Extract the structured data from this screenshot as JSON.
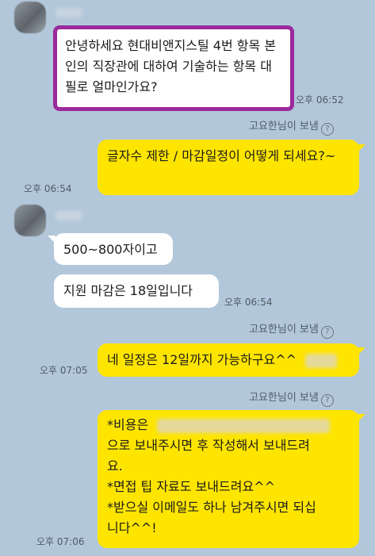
{
  "messages": [
    {
      "text": "안녕하세요 현대비앤지스틸 4번 항목 본인의 직장관에 대하여 기술하는 항목 대필로 얼마인가요?",
      "time": "오후 06:52"
    },
    {
      "text": "글자수 제한 / 마감일정이 어떻게 되세요?~",
      "time": "오후 06:54"
    },
    {
      "text": "500~800자이고"
    },
    {
      "text": "지원 마감은 18일입니다",
      "time": "오후 06:54"
    },
    {
      "text": "네 일정은 12일까지 가능하구요^^",
      "time": "오후 07:05"
    },
    {
      "text_lines": [
        "*비용은",
        "으로 보내주시면 후 작성해서 보내드려",
        "요.",
        "*면접 팁 자료도 보내드려요^^",
        "*받으실 이메일도 하나 남겨주시면 되십",
        "니다^^!"
      ],
      "time": "오후 07:06"
    }
  ],
  "sent_via": "고요한님이 보냄",
  "help_icon": "?",
  "icons": [
    "help-circle-icon"
  ],
  "colors": {
    "background": "#b2c7da",
    "my_bubble": "#fee500",
    "their_bubble": "#ffffff",
    "highlight": "#9b2a9c"
  }
}
